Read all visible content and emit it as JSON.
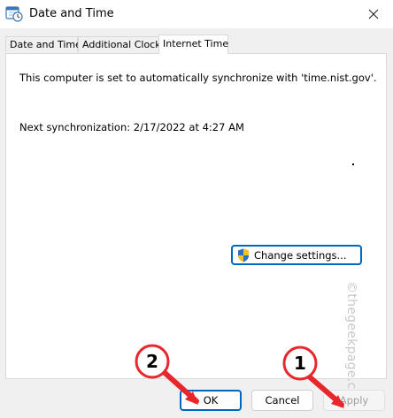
{
  "window": {
    "title": "Date and Time",
    "close_glyph": "✕"
  },
  "tabs": [
    {
      "label": "Date and Time",
      "active": false
    },
    {
      "label": "Additional Clocks",
      "active": false
    },
    {
      "label": "Internet Time",
      "active": true
    }
  ],
  "internet_time": {
    "sync_message": "This computer is set to automatically synchronize with 'time.nist.gov'.",
    "next_sync": "Next synchronization: 2/17/2022 at 4:27 AM",
    "change_settings_label": "Change settings..."
  },
  "buttons": {
    "ok": "OK",
    "cancel": "Cancel",
    "apply": "Apply"
  },
  "annotations": [
    {
      "number": "2",
      "target": "ok"
    },
    {
      "number": "1",
      "target": "apply"
    }
  ],
  "watermark": "©thegeekpage.com",
  "colors": {
    "accent": "#0067c0",
    "annotation_red": "#e8262b",
    "disabled_text": "#a0a0a0"
  },
  "icons": {
    "title": "calendar-clock-icon",
    "close": "close-icon",
    "change_settings": "uac-shield-icon"
  }
}
